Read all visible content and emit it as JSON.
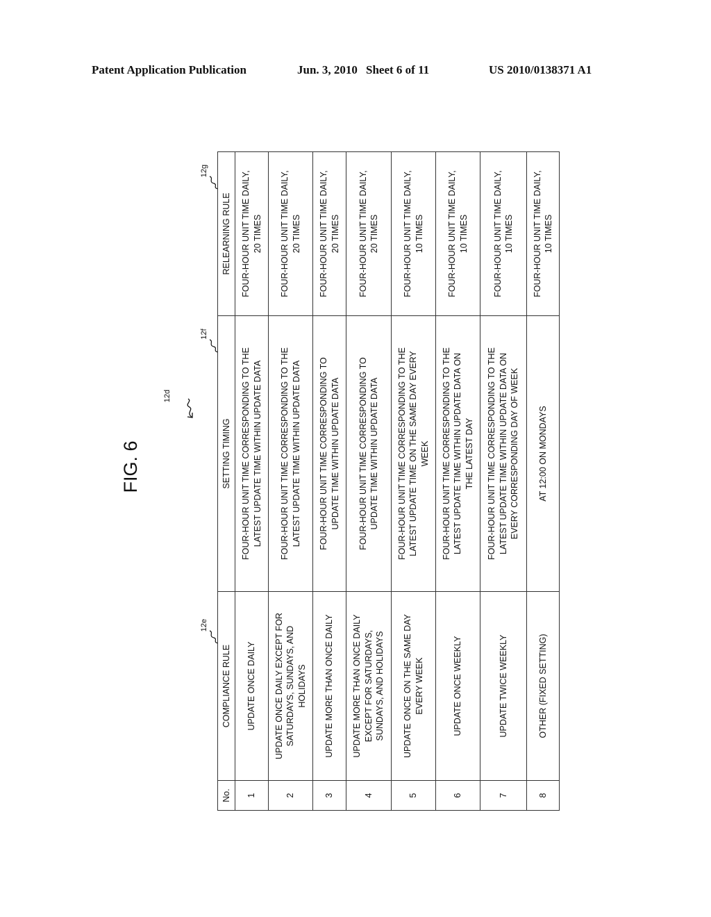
{
  "header": {
    "publication": "Patent Application Publication",
    "date": "Jun. 3, 2010",
    "sheet": "Sheet 6 of 11",
    "number": "US 2010/0138371 A1"
  },
  "figure": {
    "title": "FIG. 6",
    "table_ref": "12d",
    "column_refs": {
      "compliance_rule": "12e",
      "setting_timing": "12f",
      "relearning_rule": "12g"
    }
  },
  "table": {
    "columns": [
      "No.",
      "COMPLIANCE RULE",
      "SETTING TIMING",
      "RELEARNING RULE"
    ],
    "rows": [
      {
        "no": "1",
        "compliance_rule": [
          "UPDATE ONCE DAILY"
        ],
        "setting_timing": [
          "FOUR-HOUR UNIT TIME CORRESPONDING TO THE",
          "LATEST UPDATE TIME WITHIN UPDATE DATA"
        ],
        "relearning_rule": [
          "FOUR-HOUR UNIT TIME DAILY,",
          "20 TIMES"
        ]
      },
      {
        "no": "2",
        "compliance_rule": [
          "UPDATE ONCE DAILY EXCEPT FOR",
          "SATURDAYS, SUNDAYS, AND",
          "HOLIDAYS"
        ],
        "setting_timing": [
          "FOUR-HOUR UNIT TIME CORRESPONDING TO THE",
          "LATEST UPDATE TIME WITHIN UPDATE DATA"
        ],
        "relearning_rule": [
          "FOUR-HOUR UNIT TIME DAILY,",
          "20 TIMES"
        ]
      },
      {
        "no": "3",
        "compliance_rule": [
          "UPDATE MORE THAN ONCE DAILY"
        ],
        "setting_timing": [
          "FOUR-HOUR UNIT TIME CORRESPONDING TO",
          "UPDATE TIME WITHIN UPDATE DATA"
        ],
        "relearning_rule": [
          "FOUR-HOUR UNIT TIME DAILY,",
          "20 TIMES"
        ]
      },
      {
        "no": "4",
        "compliance_rule": [
          "UPDATE MORE THAN ONCE DAILY",
          "EXCEPT FOR SATURDAYS,",
          "SUNDAYS, AND HOLIDAYS"
        ],
        "setting_timing": [
          "FOUR-HOUR UNIT TIME CORRESPONDING TO",
          "UPDATE TIME WITHIN UPDATE DATA"
        ],
        "relearning_rule": [
          "FOUR-HOUR UNIT TIME DAILY,",
          "20 TIMES"
        ]
      },
      {
        "no": "5",
        "compliance_rule": [
          "UPDATE ONCE ON THE SAME DAY",
          "EVERY WEEK"
        ],
        "setting_timing": [
          "FOUR-HOUR UNIT TIME CORRESPONDING TO THE",
          "LATEST UPDATE TIME ON THE SAME DAY EVERY",
          "WEEK"
        ],
        "relearning_rule": [
          "FOUR-HOUR UNIT TIME DAILY,",
          "10 TIMES"
        ]
      },
      {
        "no": "6",
        "compliance_rule": [
          "UPDATE ONCE WEEKLY"
        ],
        "setting_timing": [
          "FOUR-HOUR UNIT TIME CORRESPONDING TO THE",
          "LATEST UPDATE TIME WITHIN UPDATE DATA ON",
          "THE LATEST DAY"
        ],
        "relearning_rule": [
          "FOUR-HOUR UNIT TIME DAILY,",
          "10 TIMES"
        ]
      },
      {
        "no": "7",
        "compliance_rule": [
          "UPDATE TWICE WEEKLY"
        ],
        "setting_timing": [
          "FOUR-HOUR UNIT TIME CORRESPONDING TO THE",
          "LATEST UPDATE TIME WITHIN UPDATE DATA ON",
          "EVERY CORRESPONDING DAY OF WEEK"
        ],
        "relearning_rule": [
          "FOUR-HOUR UNIT TIME DAILY,",
          "10 TIMES"
        ]
      },
      {
        "no": "8",
        "compliance_rule": [
          "OTHER (FIXED SETTING)"
        ],
        "setting_timing": [
          "AT 12:00 ON MONDAYS"
        ],
        "relearning_rule": [
          "FOUR-HOUR UNIT TIME DAILY,",
          "10 TIMES"
        ]
      }
    ]
  }
}
